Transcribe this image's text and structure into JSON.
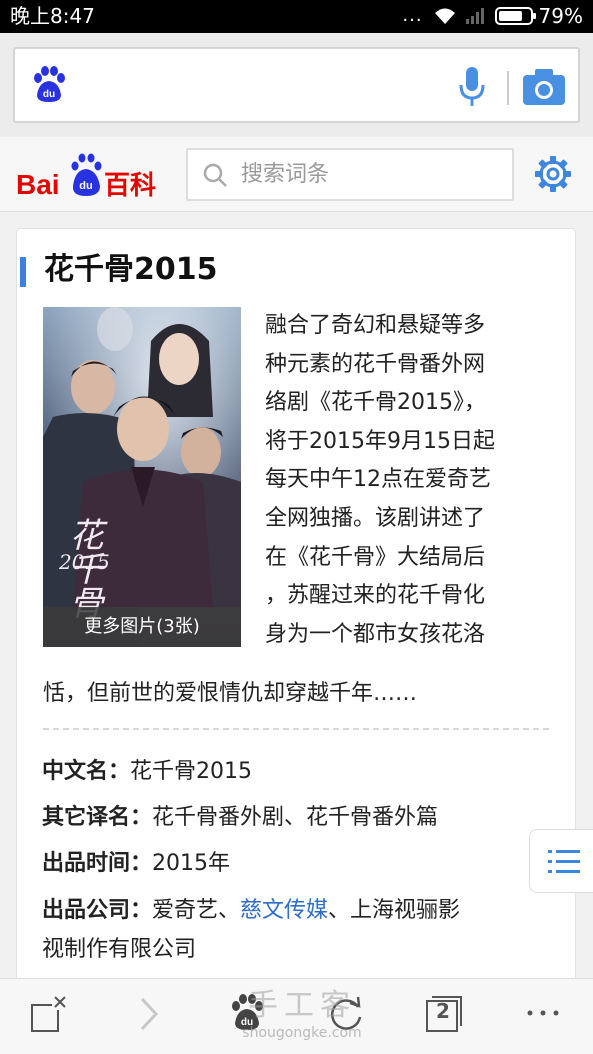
{
  "status_bar": {
    "time": "晚上8:47",
    "dots": "...",
    "battery_percent": 79,
    "battery_label": "79%"
  },
  "browser": {
    "search_placeholder": "",
    "icons": [
      "baidu-paw-icon",
      "microphone-icon",
      "camera-icon"
    ]
  },
  "baike_header": {
    "logo_text": "Bai百科",
    "logo_mark": "du",
    "search_placeholder": "搜索词条",
    "settings_icon": "gear-icon"
  },
  "article": {
    "title": "花千骨2015",
    "poster": {
      "caption": "更多图片(3张)",
      "overlay_title": "花千骨",
      "overlay_year": "2015"
    },
    "summary_lines": [
      "融合了奇幻和悬疑等多",
      "种元素的花千骨番外网",
      "络剧《花千骨2015》，",
      "将于2015年9月15日起",
      "每天中午12点在爱奇艺",
      "全网独播。该剧讲述了",
      "在《花千骨》大结局后",
      "，苏醒过来的花千骨化",
      "身为一个都市女孩花洛"
    ],
    "summary_last": "恬，但前世的爱恨情仇却穿越千年……",
    "info": [
      {
        "key": "中文名：",
        "value": "花千骨2015"
      },
      {
        "key": "其它译名：",
        "value": "花千骨番外剧、花千骨番外篇"
      },
      {
        "key": "出品时间：",
        "value": "2015年"
      },
      {
        "key": "出品公司：",
        "value_before": "爱奇艺、",
        "link": "慈文传媒",
        "value_after": "、上海视骊影",
        "value_line2": "视制作有限公司"
      }
    ]
  },
  "floating": {
    "icon": "list-icon"
  },
  "bottom_bar": {
    "tab_count": "2",
    "watermark_cn": "手工客",
    "watermark_en": "shougongke.com",
    "icons": [
      "close-page-icon",
      "forward-icon",
      "baidu-home-icon",
      "refresh-icon",
      "tabs-icon",
      "more-icon"
    ]
  },
  "colors": {
    "accent_blue": "#3d7ee0",
    "link_blue": "#2d6dcc",
    "baidu_red": "#e10601",
    "baidu_blue": "#2932e1"
  }
}
